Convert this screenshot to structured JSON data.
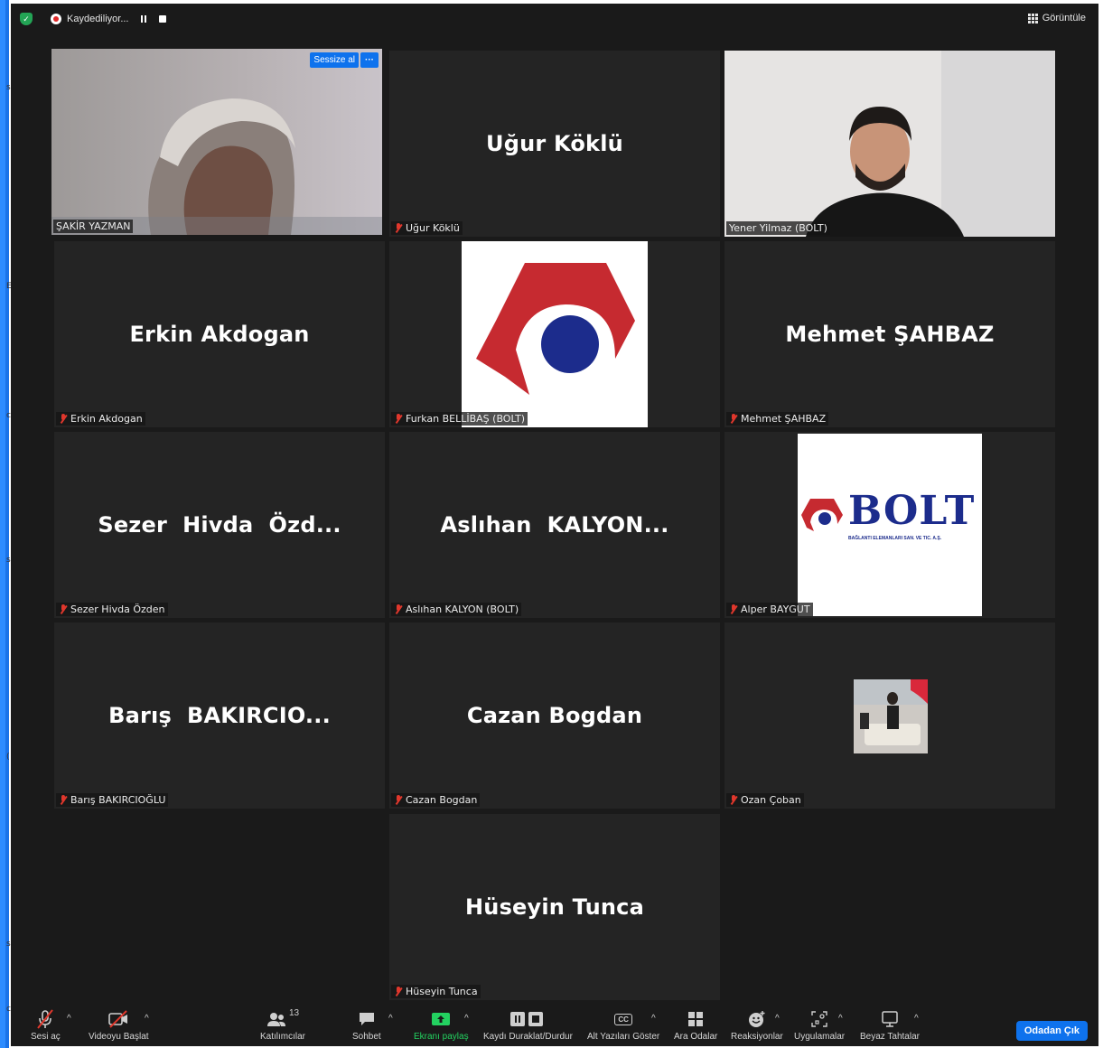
{
  "topbar": {
    "recording_label": "Kaydediliyor...",
    "view_label": "Görüntüle"
  },
  "speaker_overlay": {
    "mute_label": "Sessize al",
    "more_label": "···"
  },
  "tiles": [
    {
      "display": "",
      "label": "ŞAKİR YAZMAN",
      "muted": false,
      "kind": "video"
    },
    {
      "display": "Uğur Köklü",
      "label": "Uğur Köklü",
      "muted": true,
      "kind": "name"
    },
    {
      "display": "",
      "label": "Yener Yilmaz (BOLT)",
      "muted": false,
      "kind": "video"
    },
    {
      "display": "Erkin Akdogan",
      "label": "Erkin Akdogan",
      "muted": true,
      "kind": "name"
    },
    {
      "display": "",
      "label": "Furkan BELLİBAŞ (BOLT)",
      "muted": true,
      "kind": "logo-mark"
    },
    {
      "display": "Mehmet ŞAHBAZ",
      "label": "Mehmet ŞAHBAZ",
      "muted": true,
      "kind": "name"
    },
    {
      "display": "Sezer  Hivda  Özd...",
      "label": "Sezer Hivda Özden",
      "muted": true,
      "kind": "name"
    },
    {
      "display": "Aslıhan  KALYON...",
      "label": "Aslıhan KALYON (BOLT)",
      "muted": true,
      "kind": "name"
    },
    {
      "display": "",
      "label": "Alper BAYGUT",
      "muted": true,
      "kind": "logo-text"
    },
    {
      "display": "Barış  BAKIRCIO...",
      "label": "Barış BAKIRCIOĞLU",
      "muted": true,
      "kind": "name"
    },
    {
      "display": "Cazan Bogdan",
      "label": "Cazan Bogdan",
      "muted": true,
      "kind": "name"
    },
    {
      "display": "",
      "label": "Ozan Çoban",
      "muted": true,
      "kind": "photo"
    },
    {
      "display": "Hüseyin Tunca",
      "label": "Hüseyin Tunca",
      "muted": true,
      "kind": "name"
    }
  ],
  "bolt_logo": {
    "brand": "BOLT",
    "tagline": "BAĞLANTI ELEMANLARI SAN. VE TIC. A.Ş."
  },
  "toolbar": {
    "unmute_label": "Sesi aç",
    "start_video_label": "Videoyu Başlat",
    "participants_label": "Katılımcılar",
    "participants_count": "13",
    "chat_label": "Sohbet",
    "share_label": "Ekranı paylaş",
    "record_label": "Kaydı Duraklat/Durdur",
    "captions_label": "Alt Yazıları Göster",
    "captions_icon_text": "CC",
    "breakout_label": "Ara Odalar",
    "reactions_label": "Reaksiyonlar",
    "apps_label": "Uygulamalar",
    "whiteboard_label": "Beyaz Tahtalar",
    "leave_label": "Odadan Çık"
  },
  "colors": {
    "background": "#1a1a1a",
    "tile": "#242424",
    "active_speaker": "#d8e85a",
    "accent": "#0e72ed",
    "share_green": "#23d160",
    "muted_red": "#e0372c",
    "bolt_red": "#c62a30",
    "bolt_blue": "#1c2c8c"
  }
}
